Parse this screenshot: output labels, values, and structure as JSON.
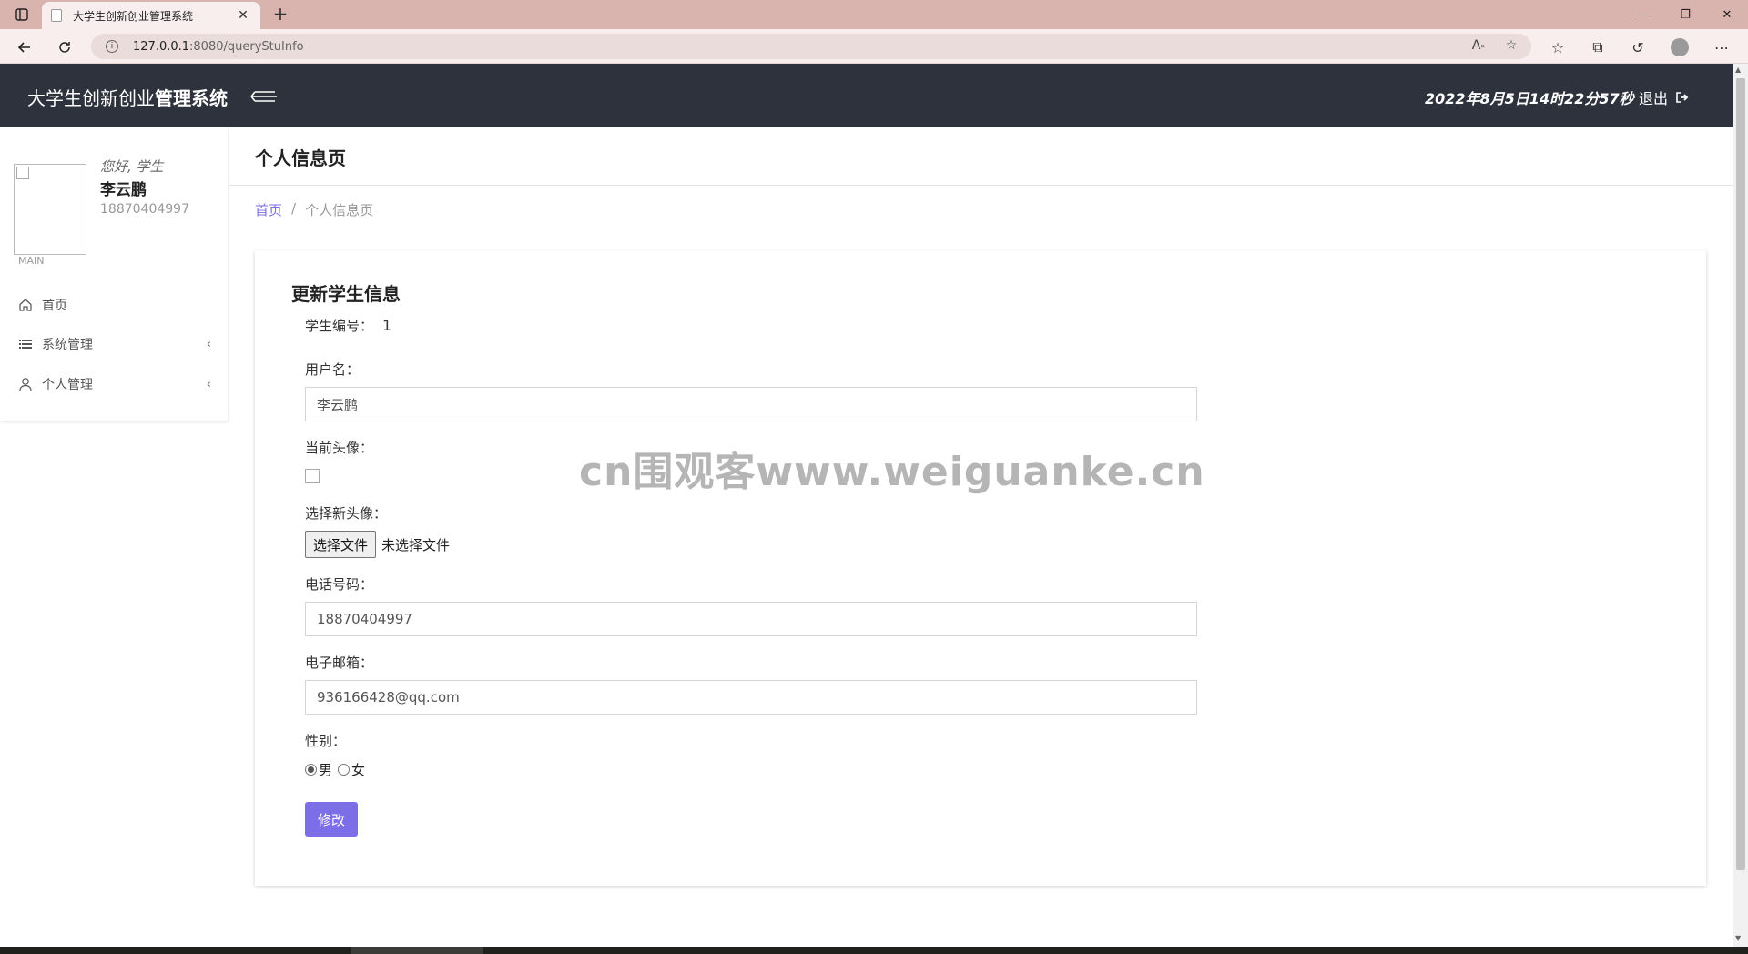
{
  "browser": {
    "tab_title": "大学生创新创业管理系统",
    "url_host": "127.0.0.1",
    "url_path": ":8080/queryStuInfo"
  },
  "header": {
    "brand_normal": "大学生创新创业",
    "brand_bold": "管理系统",
    "datetime": "2022年8月5日14时22分57秒",
    "logout_label": "退出"
  },
  "sidebar": {
    "greeting": "您好, 学生",
    "user_name": "李云鹏",
    "user_phone": "18870404997",
    "section_label": "MAIN",
    "items": [
      {
        "label": "首页"
      },
      {
        "label": "系统管理"
      },
      {
        "label": "个人管理"
      }
    ]
  },
  "page": {
    "title": "个人信息页",
    "breadcrumb_home": "首页",
    "breadcrumb_sep": "/",
    "breadcrumb_current": "个人信息页"
  },
  "form": {
    "title": "更新学生信息",
    "student_id_label": "学生编号：",
    "student_id_value": "1",
    "username_label": "用户名：",
    "username_value": "李云鹏",
    "current_avatar_label": "当前头像：",
    "new_avatar_label": "选择新头像：",
    "file_button_label": "选择文件",
    "file_status": "未选择文件",
    "phone_label": "电话号码：",
    "phone_value": "18870404997",
    "email_label": "电子邮箱：",
    "email_value": "936166428@qq.com",
    "gender_label": "性别：",
    "gender_options": [
      "男",
      "女"
    ],
    "gender_selected": "男",
    "submit_label": "修改"
  },
  "watermark": "cn围观客www.weiguanke.cn",
  "colors": {
    "header_bg": "#2e323d",
    "accent": "#7b6ee6",
    "tabbar_bg": "#d9b3ae"
  }
}
